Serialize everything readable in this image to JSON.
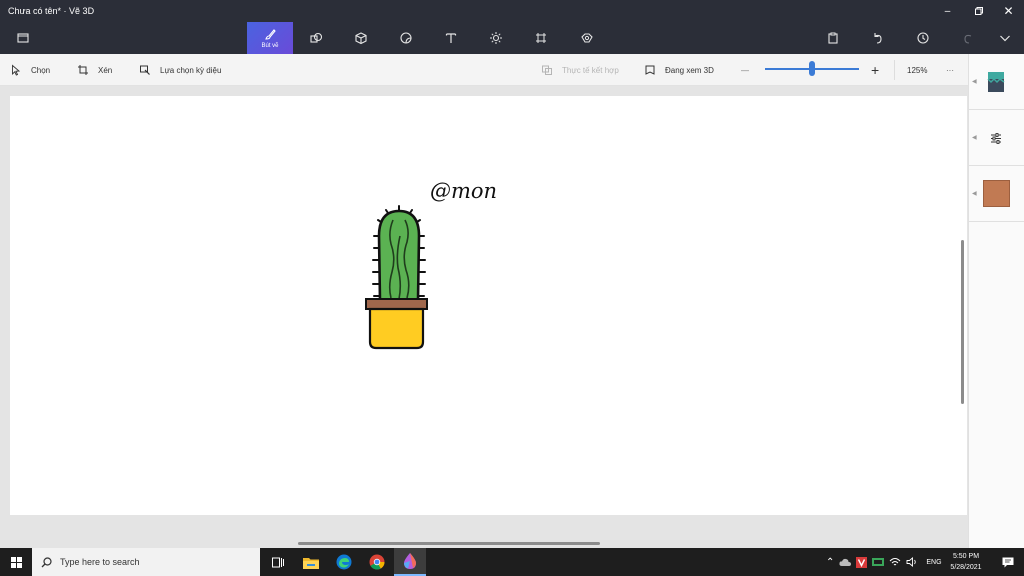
{
  "window": {
    "title": "Chưa có tên* · Vẽ 3D"
  },
  "ribbon": {
    "brushes_label": "Bút vẽ",
    "tools": [
      "brushes-icon",
      "2d-shapes-icon",
      "3d-shapes-icon",
      "stickers-icon",
      "text-icon",
      "effects-icon",
      "canvas-icon",
      "3d-library-icon"
    ],
    "right_tools": [
      "paste-icon",
      "undo-icon",
      "history-icon",
      "redo-icon",
      "expand-icon"
    ]
  },
  "toolbar": {
    "select_label": "Chọn",
    "crop_label": "Xén",
    "magic_select_label": "Lựa chọn kỳ diệu",
    "mixed_reality_label": "Thực tế kết hợp",
    "view_3d_label": "Đang xem 3D",
    "zoom_value": "125%",
    "zoom_minus": "—",
    "zoom_plus": "+",
    "more": "···"
  },
  "canvas": {
    "signature_text": "@mon"
  },
  "colors": {
    "titlebar": "#2b2e38",
    "accent": "#3b7bd6",
    "swatch": "#c17a53",
    "cactus": "#5bb252",
    "pot": "#ffcc22",
    "pot_rim": "#a0674c"
  },
  "taskbar": {
    "search_placeholder": "Type here to search",
    "time": "5:50 PM",
    "date": "5/28/2021",
    "lang": "ENG"
  }
}
